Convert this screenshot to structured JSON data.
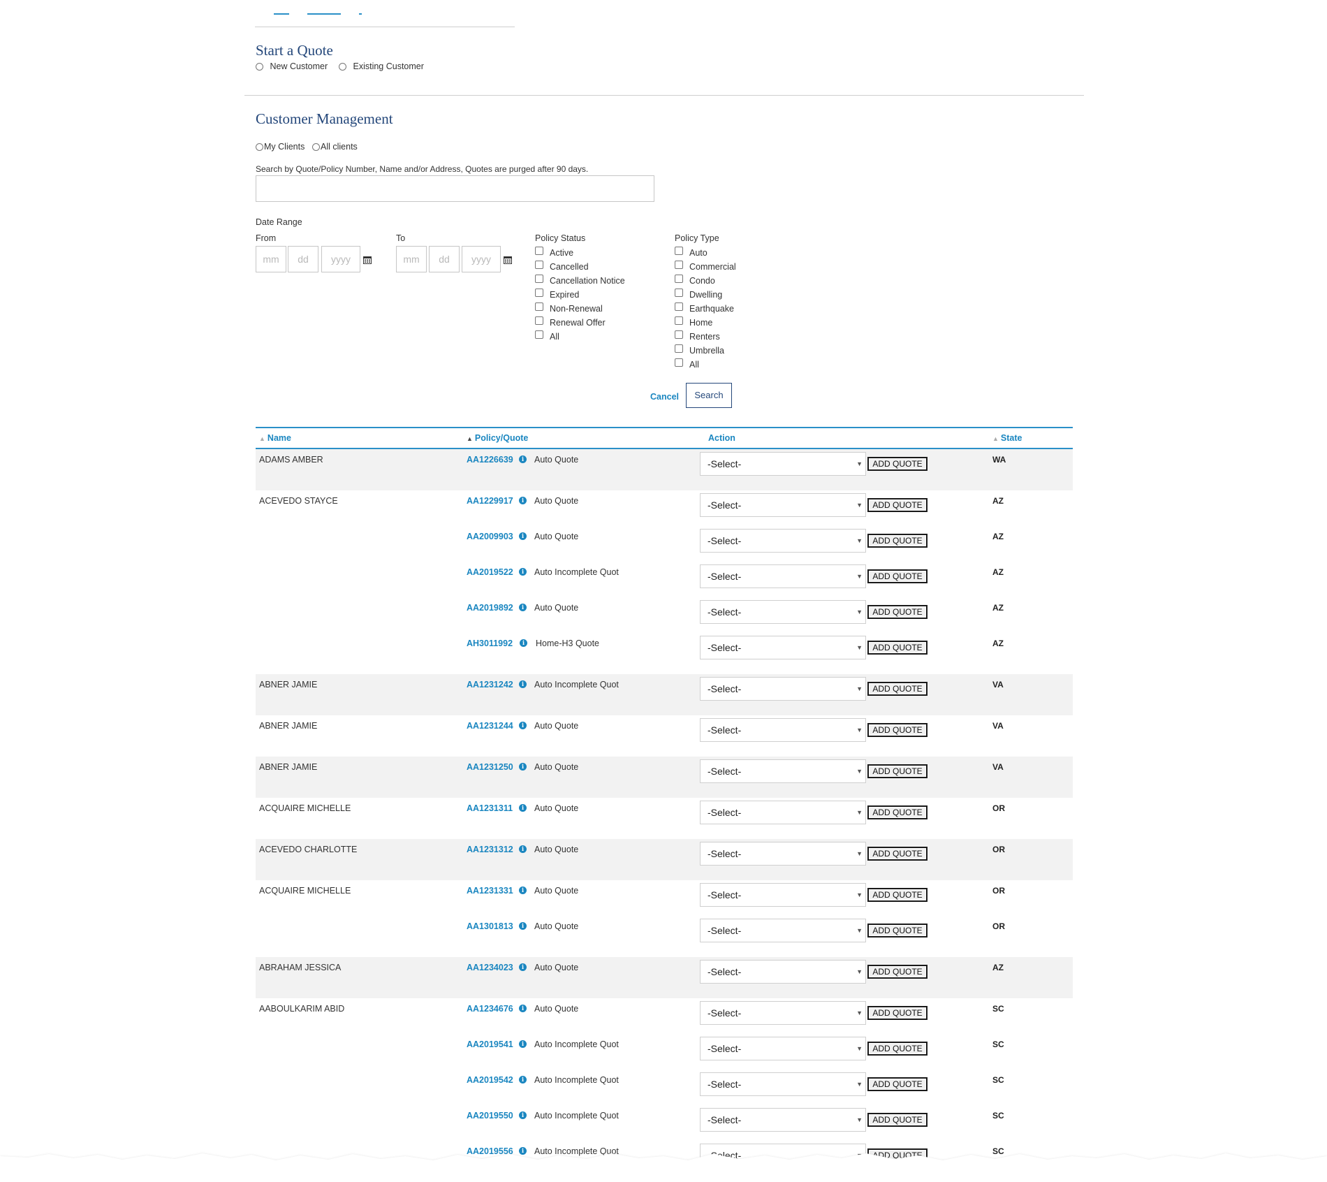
{
  "start_quote": {
    "title": "Start a Quote",
    "options": [
      "New Customer",
      "Existing Customer"
    ]
  },
  "customer_management": {
    "title": "Customer Management",
    "scope_options": [
      "My Clients",
      "All clients"
    ],
    "search_label": "Search by Quote/Policy Number, Name and/or Address, Quotes are purged after 90 days.",
    "search_value": "",
    "date_range_label": "Date Range",
    "from_label": "From",
    "to_label": "To",
    "date_placeholders": {
      "mm": "mm",
      "dd": "dd",
      "yyyy": "yyyy"
    },
    "policy_status": {
      "label": "Policy Status",
      "options": [
        "Active",
        "Cancelled",
        "Cancellation Notice",
        "Expired",
        "Non-Renewal",
        "Renewal Offer",
        "All"
      ]
    },
    "policy_type": {
      "label": "Policy Type",
      "options": [
        "Auto",
        "Commercial",
        "Condo",
        "Dwelling",
        "Earthquake",
        "Home",
        "Renters",
        "Umbrella",
        "All"
      ]
    },
    "cancel_label": "Cancel",
    "search_button": "Search"
  },
  "table": {
    "headers": {
      "name": "Name",
      "policy": "Policy/Quote",
      "action": "Action",
      "state": "State"
    },
    "select_value": "-Select-",
    "add_quote_label": "ADD QUOTE",
    "groups": [
      {
        "name": "ADAMS AMBER",
        "shade": true,
        "items": [
          {
            "policy": "AA1226639",
            "desc": "Auto Quote",
            "state": "WA"
          }
        ]
      },
      {
        "name": "ACEVEDO STAYCE",
        "shade": false,
        "items": [
          {
            "policy": "AA1229917",
            "desc": "Auto Quote",
            "state": "AZ"
          },
          {
            "policy": "AA2009903",
            "desc": "Auto Quote",
            "state": "AZ"
          },
          {
            "policy": "AA2019522",
            "desc": "Auto Incomplete Quot",
            "state": "AZ"
          },
          {
            "policy": "AA2019892",
            "desc": "Auto Quote",
            "state": "AZ"
          },
          {
            "policy": "AH3011992",
            "desc": "Home-H3 Quote",
            "state": "AZ"
          }
        ]
      },
      {
        "name": "ABNER JAMIE",
        "shade": true,
        "items": [
          {
            "policy": "AA1231242",
            "desc": "Auto Incomplete Quot",
            "state": "VA"
          }
        ]
      },
      {
        "name": "ABNER JAMIE",
        "shade": false,
        "items": [
          {
            "policy": "AA1231244",
            "desc": "Auto Quote",
            "state": "VA"
          }
        ]
      },
      {
        "name": "ABNER JAMIE",
        "shade": true,
        "items": [
          {
            "policy": "AA1231250",
            "desc": "Auto Quote",
            "state": "VA"
          }
        ]
      },
      {
        "name": "ACQUAIRE MICHELLE",
        "shade": false,
        "items": [
          {
            "policy": "AA1231311",
            "desc": "Auto Quote",
            "state": "OR"
          }
        ]
      },
      {
        "name": "ACEVEDO CHARLOTTE",
        "shade": true,
        "items": [
          {
            "policy": "AA1231312",
            "desc": "Auto Quote",
            "state": "OR"
          }
        ]
      },
      {
        "name": "ACQUAIRE MICHELLE",
        "shade": false,
        "items": [
          {
            "policy": "AA1231331",
            "desc": "Auto Quote",
            "state": "OR"
          },
          {
            "policy": "AA1301813",
            "desc": "Auto Quote",
            "state": "OR"
          }
        ]
      },
      {
        "name": "ABRAHAM JESSICA",
        "shade": true,
        "items": [
          {
            "policy": "AA1234023",
            "desc": "Auto Quote",
            "state": "AZ"
          }
        ]
      },
      {
        "name": "AABOULKARIM ABID",
        "shade": false,
        "items": [
          {
            "policy": "AA1234676",
            "desc": "Auto Quote",
            "state": "SC"
          },
          {
            "policy": "AA2019541",
            "desc": "Auto Incomplete Quot",
            "state": "SC"
          },
          {
            "policy": "AA2019542",
            "desc": "Auto Incomplete Quot",
            "state": "SC"
          },
          {
            "policy": "AA2019550",
            "desc": "Auto Incomplete Quot",
            "state": "SC"
          },
          {
            "policy": "AA2019556",
            "desc": "Auto Incomplete Quot",
            "state": "SC"
          }
        ]
      }
    ]
  },
  "colors": {
    "brand_navy": "#24477a",
    "link_blue": "#1a86c0",
    "row_shade": "#f2f2f2"
  }
}
